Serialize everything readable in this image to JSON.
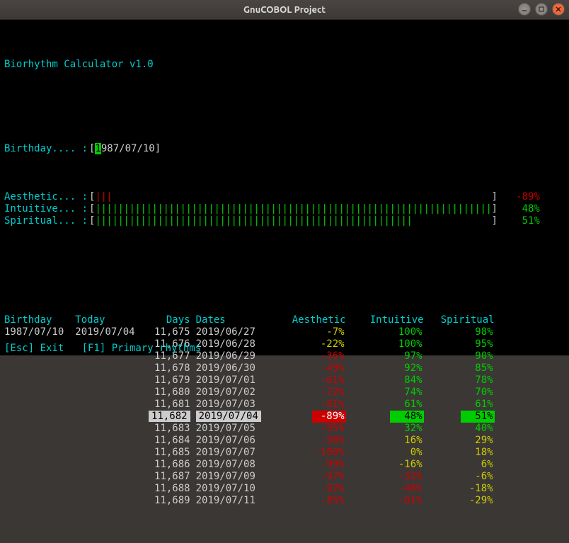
{
  "window": {
    "title": "GnuCOBOL Project"
  },
  "app": {
    "title": "Biorhythm Calculator v1.0",
    "birthday_label": "Birthday.... :",
    "birthday_value": "1987/07/10",
    "bars": [
      {
        "label": "Aesthetic... :",
        "ticks": 3,
        "max": 70,
        "color": "red",
        "value": "-89%"
      },
      {
        "label": "Intuitive... :",
        "ticks": 70,
        "max": 70,
        "color": "green",
        "value": "48%"
      },
      {
        "label": "Spiritual... :",
        "ticks": 56,
        "max": 70,
        "color": "green",
        "value": "51%"
      }
    ],
    "headers": {
      "birthday": "Birthday",
      "today": "Today",
      "days": "Days",
      "dates": "Dates",
      "aesthetic": "Aesthetic",
      "intuitive": "Intuitive",
      "spiritual": "Spiritual"
    },
    "birthday_col": "1987/07/10",
    "today_col": "2019/07/04",
    "rows": [
      {
        "days": "11,675",
        "date": "2019/06/27",
        "aes": "-7%",
        "aes_c": "yellow",
        "int": "100%",
        "int_c": "green",
        "spi": "98%",
        "spi_c": "green",
        "hi": false
      },
      {
        "days": "11,676",
        "date": "2019/06/28",
        "aes": "-22%",
        "aes_c": "yellow",
        "int": "100%",
        "int_c": "green",
        "spi": "95%",
        "spi_c": "green",
        "hi": false
      },
      {
        "days": "11,677",
        "date": "2019/06/29",
        "aes": "-36%",
        "aes_c": "red",
        "int": "97%",
        "int_c": "green",
        "spi": "90%",
        "spi_c": "green",
        "hi": false
      },
      {
        "days": "11,678",
        "date": "2019/06/30",
        "aes": "-49%",
        "aes_c": "red",
        "int": "92%",
        "int_c": "green",
        "spi": "85%",
        "spi_c": "green",
        "hi": false
      },
      {
        "days": "11,679",
        "date": "2019/07/01",
        "aes": "-61%",
        "aes_c": "red",
        "int": "84%",
        "int_c": "green",
        "spi": "78%",
        "spi_c": "green",
        "hi": false
      },
      {
        "days": "11,680",
        "date": "2019/07/02",
        "aes": "-72%",
        "aes_c": "red",
        "int": "74%",
        "int_c": "green",
        "spi": "70%",
        "spi_c": "green",
        "hi": false
      },
      {
        "days": "11,681",
        "date": "2019/07/03",
        "aes": "-81%",
        "aes_c": "red",
        "int": "61%",
        "int_c": "green",
        "spi": "61%",
        "spi_c": "green",
        "hi": false
      },
      {
        "days": "11,682",
        "date": "2019/07/04",
        "aes": "-89%",
        "aes_c": "red",
        "int": "48%",
        "int_c": "green",
        "spi": "51%",
        "spi_c": "green",
        "hi": true
      },
      {
        "days": "11,683",
        "date": "2019/07/05",
        "aes": "-95%",
        "aes_c": "red",
        "int": "32%",
        "int_c": "green",
        "spi": "40%",
        "spi_c": "green",
        "hi": false
      },
      {
        "days": "11,684",
        "date": "2019/07/06",
        "aes": "-98%",
        "aes_c": "red",
        "int": "16%",
        "int_c": "yellow",
        "spi": "29%",
        "spi_c": "yellow",
        "hi": false
      },
      {
        "days": "11,685",
        "date": "2019/07/07",
        "aes": "-100%",
        "aes_c": "red",
        "int": "0%",
        "int_c": "yellow",
        "spi": "18%",
        "spi_c": "yellow",
        "hi": false
      },
      {
        "days": "11,686",
        "date": "2019/07/08",
        "aes": "-99%",
        "aes_c": "red",
        "int": "-16%",
        "int_c": "yellow",
        "spi": "6%",
        "spi_c": "yellow",
        "hi": false
      },
      {
        "days": "11,687",
        "date": "2019/07/09",
        "aes": "-97%",
        "aes_c": "red",
        "int": "-32%",
        "int_c": "red",
        "spi": "-6%",
        "spi_c": "yellow",
        "hi": false
      },
      {
        "days": "11,688",
        "date": "2019/07/10",
        "aes": "-92%",
        "aes_c": "red",
        "int": "-48%",
        "int_c": "red",
        "spi": "-18%",
        "spi_c": "yellow",
        "hi": false
      },
      {
        "days": "11,689",
        "date": "2019/07/11",
        "aes": "-85%",
        "aes_c": "red",
        "int": "-61%",
        "int_c": "red",
        "spi": "-29%",
        "spi_c": "yellow",
        "hi": false
      }
    ],
    "footer": "[Esc] Exit   [F1] Primary rhythms"
  }
}
